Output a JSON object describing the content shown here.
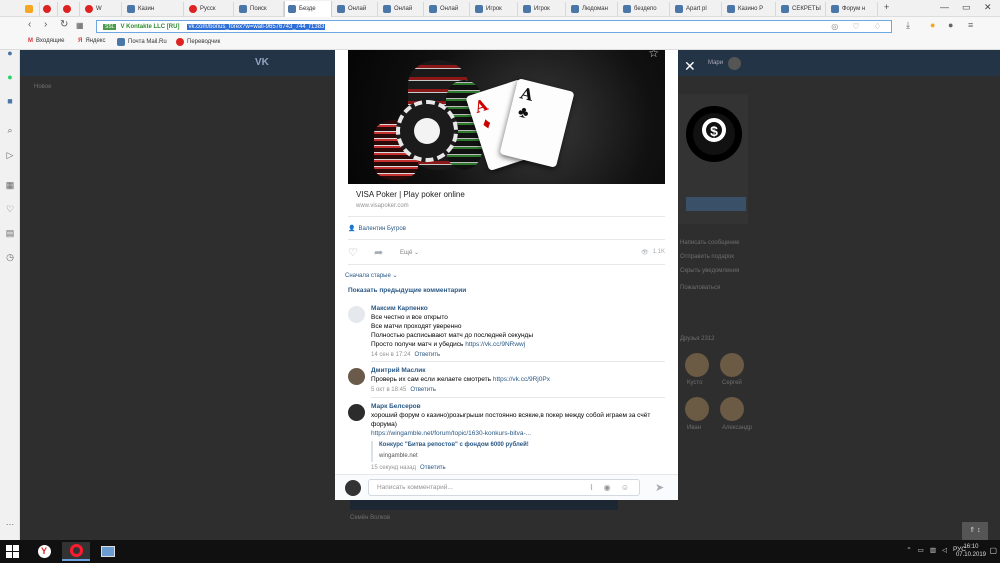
{
  "browser": {
    "tabs": [
      {
        "label": "",
        "icon": "orange-icon"
      },
      {
        "label": "",
        "icon": "opera-icon"
      },
      {
        "label": "",
        "icon": "speed-dial-icon"
      },
      {
        "label": "W",
        "icon": "w-icon"
      },
      {
        "label": "Казин",
        "icon": "vk-icon"
      },
      {
        "label": "Русск",
        "icon": "youtube-icon"
      },
      {
        "label": "Поиск",
        "icon": "vk-icon"
      },
      {
        "label": "Безде",
        "icon": "vk-icon"
      },
      {
        "label": "Онлай",
        "icon": "vk-icon"
      },
      {
        "label": "Онлай",
        "icon": "vk-icon"
      },
      {
        "label": "Онлай",
        "icon": "vk-icon"
      },
      {
        "label": "Игрок",
        "icon": "vk-icon"
      },
      {
        "label": "Игрок",
        "icon": "vk-icon"
      },
      {
        "label": "Людоман",
        "icon": "vk-icon"
      },
      {
        "label": "бездепо",
        "icon": "vk-icon"
      },
      {
        "label": "Apart pl",
        "icon": "vk-icon"
      },
      {
        "label": "Казино Р",
        "icon": "vk-icon"
      },
      {
        "label": "СЕКРЕТЫ",
        "icon": "vk-icon"
      },
      {
        "label": "Форум н",
        "icon": "vk-icon"
      }
    ],
    "ssl_badge": "SSL",
    "site_owner": "V Kontakte LLC [RU]",
    "url": "vk.com/bonus_forex?w=wall-96576743_744_r1383",
    "bookmarks": [
      "Входящие",
      "Яндекс",
      "Почта Mail.Ru",
      "Переводчик"
    ]
  },
  "vk_header": {
    "logo": "VK",
    "user_name": "Мари"
  },
  "background": {
    "status_link": "Новое",
    "right_menu": [
      "Написать сообщение",
      "Отправить подарок",
      "Скрыть уведомления",
      "Пожаловаться"
    ],
    "friends_title": "Друзья 2312",
    "friends": [
      "Кусто",
      "Сергей",
      "Иван",
      "Александр"
    ],
    "bottom_name": "Семён Волков"
  },
  "post": {
    "link_title": "VISA Poker | Play poker online",
    "link_domain": "www.visapoker.com",
    "author": "Валентин Бугров",
    "more_label": "Ещё",
    "views": "1.1K",
    "sort_label": "Сначала старые",
    "show_prev": "Показать предыдущие комментарии"
  },
  "comments": [
    {
      "name": "Максим Карпенко",
      "lines": [
        "Все честно и все открыто",
        "Все матчи проходят уверенно",
        "Полностью расписывают матч до последней секунды"
      ],
      "last_line_text": "Просто получи матч и убедись",
      "link": "https://vk.cc/9NRwwj",
      "date": "14 сен в 17:24",
      "reply": "Ответить"
    },
    {
      "name": "Дмитрий Маслик",
      "text": "Проверь их сам если желаете смотреть",
      "link": "https://vk.cc/9Rj0Px",
      "date": "5 окт в 18:45",
      "reply": "Ответить"
    },
    {
      "name": "Марк Белсеров",
      "text": "хороший форум о казино)розыгрыши постоянно всякие,в покер между собой играем за счёт форума)",
      "link": "https://wingamble.net/forum/topic/1630-konkurs-bitva-...",
      "snippet_title": "Конкурс \"Битва репостов\" с фондом 6000 рублей!",
      "snippet_domain": "wingamble.net",
      "date": "15 секунд назад",
      "reply": "Ответить"
    }
  ],
  "composer": {
    "placeholder": "Написать комментарий..."
  },
  "taskbar": {
    "lang": "РУС",
    "time": "16:10",
    "date": "07.10.2019"
  },
  "colors": {
    "vk_blue": "#2a5885",
    "vk_header": "#243447",
    "opera_red": "#ff1b2d"
  }
}
